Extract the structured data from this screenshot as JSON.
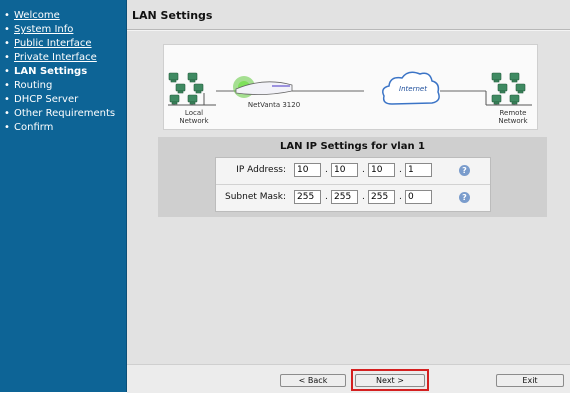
{
  "sidebar": {
    "items": [
      {
        "label": "Welcome",
        "link": true
      },
      {
        "label": "System Info",
        "link": true
      },
      {
        "label": "Public Interface",
        "link": true
      },
      {
        "label": "Private Interface",
        "link": true
      },
      {
        "label": "LAN Settings",
        "link": false,
        "current": true
      },
      {
        "label": "Routing",
        "link": false
      },
      {
        "label": "DHCP Server",
        "link": false
      },
      {
        "label": "Other Requirements",
        "link": false
      },
      {
        "label": "Confirm",
        "link": false
      }
    ]
  },
  "header": {
    "title": "LAN Settings"
  },
  "diagram": {
    "local_label_line1": "Local",
    "local_label_line2": "Network",
    "device_label": "NetVanta 3120",
    "cloud_label": "Internet",
    "remote_label_line1": "Remote",
    "remote_label_line2": "Network",
    "icons": [
      "computer-network-icon",
      "router-icon",
      "internet-cloud-icon",
      "computer-network-icon"
    ],
    "accent_color": "#5ec93a"
  },
  "ip_settings": {
    "heading": "LAN IP Settings for vlan 1",
    "ip_address": {
      "label": "IP Address:",
      "octets": [
        "10",
        "10",
        "10",
        "1"
      ]
    },
    "subnet_mask": {
      "label": "Subnet Mask:",
      "octets": [
        "255",
        "255",
        "255",
        "0"
      ]
    },
    "help_symbol": "?"
  },
  "buttons": {
    "back": "< Back",
    "next": "Next >",
    "exit": "Exit"
  },
  "colors": {
    "sidebar_bg": "#0d6496",
    "highlight": "#d42020"
  }
}
